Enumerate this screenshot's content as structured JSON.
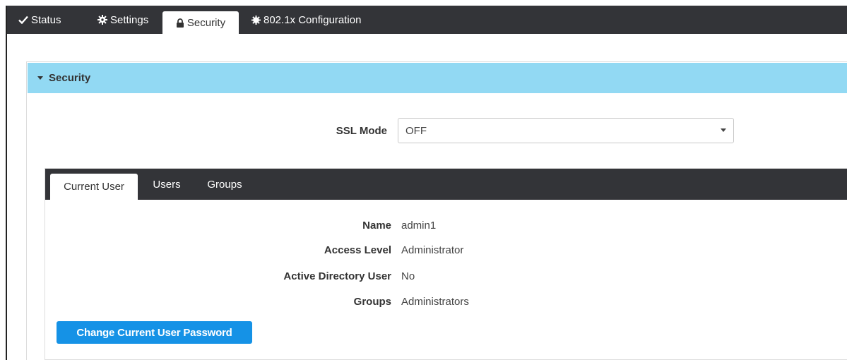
{
  "top_tabs": [
    {
      "label": "Status",
      "icon": "check-icon"
    },
    {
      "label": "Settings",
      "icon": "gear-icon"
    },
    {
      "label": "Security",
      "icon": "lock-icon",
      "active": true
    },
    {
      "label": "802.1x Configuration",
      "icon": "cog-icon"
    }
  ],
  "security_panel": {
    "title": "Security",
    "ssl_mode": {
      "label": "SSL Mode",
      "value": "OFF"
    }
  },
  "user_tabs": [
    {
      "label": "Current User",
      "active": true
    },
    {
      "label": "Users"
    },
    {
      "label": "Groups"
    }
  ],
  "current_user": {
    "fields": [
      {
        "label": "Name",
        "value": "admin1"
      },
      {
        "label": "Access Level",
        "value": "Administrator"
      },
      {
        "label": "Active Directory User",
        "value": "No"
      },
      {
        "label": "Groups",
        "value": "Administrators"
      }
    ],
    "change_password_label": "Change Current User Password"
  },
  "colors": {
    "nav_bg": "#333438",
    "panel_header_bg": "#92d9f3",
    "primary_button": "#1592e6"
  }
}
